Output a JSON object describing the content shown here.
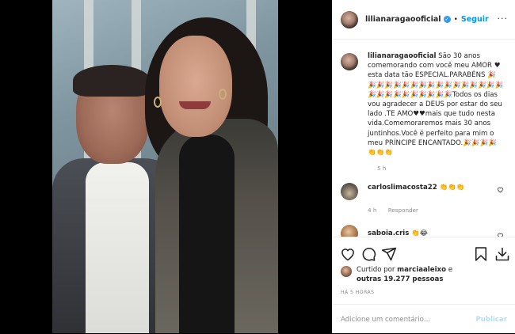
{
  "post": {
    "username": "lilianaragaooficial",
    "verified_mark": "✓",
    "separator": "•",
    "follow_label": "Seguir",
    "more_label": "···"
  },
  "caption": {
    "username": "lilianaragaooficial",
    "text": " São 30 anos comemorando com você meu AMOR ♥ esta data tão ESPECIAL.PARABÉNS 🎉🎉🎉🎉🎉🎉🎉🎉🎉🎉🎉🎉🎉🎉🎉🎉🎉🎉🎉🎉🎉🎉🎉🎉🎉🎉🎉Todos os dias vou agradecer a DEUS por estar do seu lado .TE AMO♥♥mais que tudo nesta vida.Comemoraremos mais 30 anos juntinhos.Você é perfeito para mim o meu PRÍNCIPE ENCANTADO.🎉🎉🎉🎉👏👏👏",
    "time": "5 h"
  },
  "comments": [
    {
      "username": "carloslimacosta22",
      "text": "👏👏👏",
      "time": "4 h",
      "reply_label": "Responder",
      "avatar": "eiffel-tower-avatar"
    },
    {
      "username": "saboia.cris",
      "text": "👏😂",
      "avatar": "saboia-avatar"
    }
  ],
  "icons": {
    "like": "heart-icon",
    "comment": "comment-icon",
    "share": "share-icon",
    "save": "bookmark-icon",
    "download": "download-icon",
    "comment_like": "small-heart-icon"
  },
  "likes": {
    "prefix": "Curtido por ",
    "user": "marciaaleixo",
    "middle": " e ",
    "others": "outras 19.277 pessoas"
  },
  "timestamp": "HÁ 5 HORAS",
  "add_comment": {
    "placeholder": "Adicione um comentário...",
    "publish_label": "Publicar"
  },
  "colors": {
    "accent": "#0095f6",
    "verified": "#3897f0",
    "muted": "#8e8e8e",
    "publish_disabled": "#b2dffc"
  }
}
